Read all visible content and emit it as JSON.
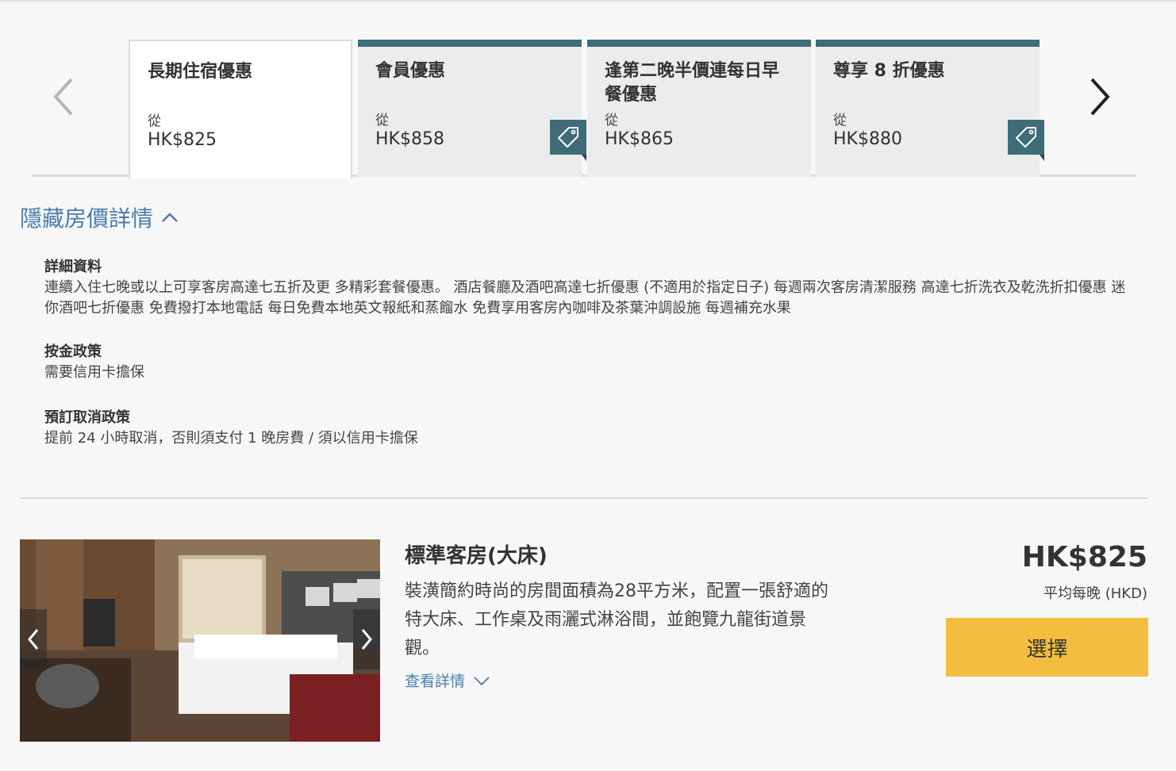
{
  "tabs": [
    {
      "title": "長期住宿優惠",
      "from": "從",
      "price": "HK$825",
      "active": true,
      "tag": false
    },
    {
      "title": "會員優惠",
      "from": "從",
      "price": "HK$858",
      "active": false,
      "tag": true
    },
    {
      "title": "逢第二晚半價連每日早餐優惠",
      "from": "從",
      "price": "HK$865",
      "active": false,
      "tag": false
    },
    {
      "title": "尊享 8 折優惠",
      "from": "從",
      "price": "HK$880",
      "active": false,
      "tag": true
    }
  ],
  "hide_details_label": "隱藏房價詳情",
  "details": {
    "info_heading": "詳細資料",
    "info_text": "連續入住七晚或以上可享客房高達七五折及更 多精彩套餐優惠。 酒店餐廳及酒吧高達七折優惠 (不適用於指定日子) 每週兩次客房清潔服務 高達七折洗衣及乾洗折扣優惠 迷你酒吧七折優惠 免費撥打本地電話 每日免費本地英文報紙和蒸餾水 免費享用客房內咖啡及茶葉沖調設施 每週補充水果",
    "deposit_heading": "按金政策",
    "deposit_text": "需要信用卡擔保",
    "cancel_heading": "預訂取消政策",
    "cancel_text": "提前 24 小時取消，否則須支付 1 晚房費 / 須以信用卡擔保"
  },
  "room": {
    "title": "標準客房(大床)",
    "description": "裝潢簡約時尚的房間面積為28平方米，配置一張舒適的特大床、工作桌及雨灑式淋浴間，並飽覽九龍街道景觀。",
    "view_details_label": "查看詳情",
    "price": "HK$825",
    "price_note": "平均每晚 (HKD)",
    "select_label": "選擇"
  },
  "colors": {
    "accent_teal": "#3e6c78",
    "link_blue": "#4a7cae",
    "select_yellow": "#f3bd3f"
  }
}
